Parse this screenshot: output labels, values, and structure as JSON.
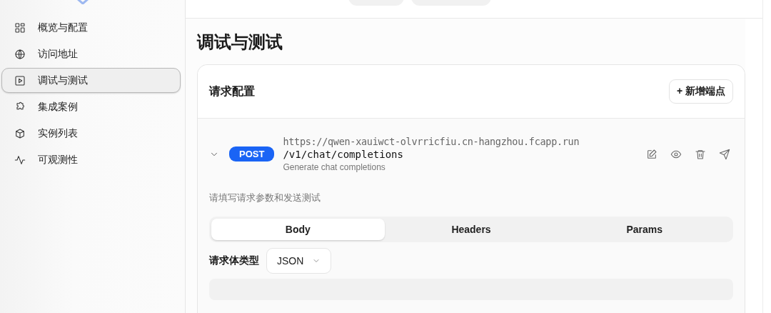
{
  "sidebar": {
    "items": [
      {
        "label": "概览与配置",
        "selected": false
      },
      {
        "label": "访问地址",
        "selected": false
      },
      {
        "label": "调试与测试",
        "selected": true
      },
      {
        "label": "集成案例",
        "selected": false
      },
      {
        "label": "实例列表",
        "selected": false
      },
      {
        "label": "可观测性",
        "selected": false
      }
    ]
  },
  "page_title": "调试与测试",
  "card": {
    "title": "请求配置",
    "add_button": "+ 新增端点",
    "endpoint": {
      "expanded": true,
      "method": "POST",
      "base_url": "https://qwen-xauiwct-olvrricfiu.cn-hangzhou.fcapp.run",
      "path": "/v1/chat/completions",
      "description": "Generate chat completions"
    },
    "hint": "请填写请求参数和发送测试",
    "tabs": [
      {
        "label": "Body",
        "selected": true
      },
      {
        "label": "Headers",
        "selected": false
      },
      {
        "label": "Params",
        "selected": false
      }
    ],
    "body_type": {
      "label": "请求体类型",
      "value": "JSON"
    }
  }
}
